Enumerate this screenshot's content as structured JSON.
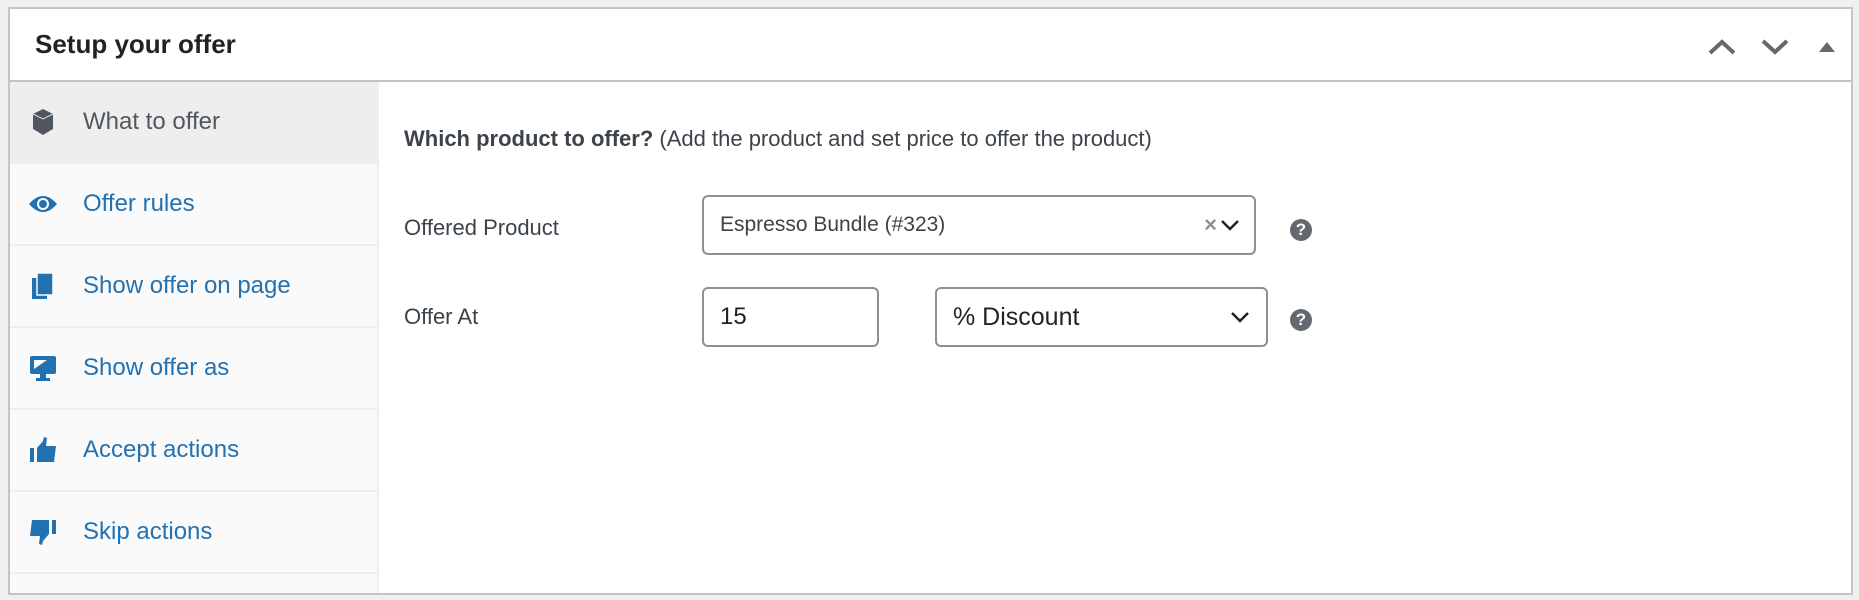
{
  "panel": {
    "title": "Setup your offer",
    "controls": [
      {
        "name": "move-up",
        "icon": "chevron-up-icon"
      },
      {
        "name": "move-down",
        "icon": "chevron-down-icon"
      },
      {
        "name": "toggle-panel",
        "icon": "triangle-up-icon"
      }
    ]
  },
  "sidebar": {
    "items": [
      {
        "label": "What to offer",
        "icon": "box-icon",
        "active": true
      },
      {
        "label": "Offer rules",
        "icon": "eye-icon"
      },
      {
        "label": "Show offer on page",
        "icon": "pages-icon"
      },
      {
        "label": "Show offer as",
        "icon": "desktop-icon"
      },
      {
        "label": "Accept actions",
        "icon": "thumbs-up-icon"
      },
      {
        "label": "Skip actions",
        "icon": "thumbs-down-icon"
      }
    ]
  },
  "main": {
    "question_bold": "Which product to offer?",
    "question_hint": " (Add the product and set price to offer the product)",
    "offered_product": {
      "label": "Offered Product",
      "value": "Espresso Bundle (#323)",
      "clear": "×"
    },
    "offer_at": {
      "label": "Offer At",
      "amount": "15",
      "type": "% Discount"
    },
    "help": "?"
  },
  "colors": {
    "link": "#2271b1",
    "border": "#c3c4c7",
    "text": "#3c434a"
  }
}
